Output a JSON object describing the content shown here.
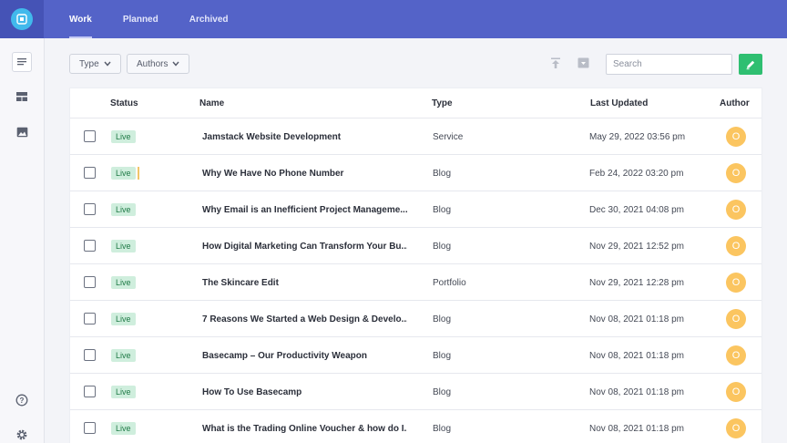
{
  "header": {
    "tabs": [
      {
        "label": "Work",
        "active": true
      },
      {
        "label": "Planned",
        "active": false
      },
      {
        "label": "Archived",
        "active": false
      }
    ]
  },
  "sidebar": {
    "items": [
      {
        "icon": "document-lines-icon",
        "active": true
      },
      {
        "icon": "layout-blocks-icon",
        "active": false
      },
      {
        "icon": "image-icon",
        "active": false
      }
    ],
    "bottom": [
      {
        "icon": "help-circle-icon"
      },
      {
        "icon": "gear-icon"
      }
    ]
  },
  "toolbar": {
    "type_filter": "Type",
    "authors_filter": "Authors",
    "search_placeholder": "Search",
    "search_value": ""
  },
  "table": {
    "columns": [
      "Status",
      "Name",
      "Type",
      "Last Updated",
      "Author"
    ],
    "rows": [
      {
        "status": "Live",
        "name": "Jamstack Website Development",
        "type": "Service",
        "updated": "May 29, 2022 03:56 pm",
        "author": "O"
      },
      {
        "status": "Live",
        "name": "Why We Have No Phone Number",
        "type": "Blog",
        "updated": "Feb 24, 2022 03:20 pm",
        "author": "O"
      },
      {
        "status": "Live",
        "name": "Why Email is an Inefficient Project Manageme...",
        "type": "Blog",
        "updated": "Dec 30, 2021 04:08 pm",
        "author": "O"
      },
      {
        "status": "Live",
        "name": "How Digital Marketing Can Transform Your Bu...",
        "type": "Blog",
        "updated": "Nov 29, 2021 12:52 pm",
        "author": "O"
      },
      {
        "status": "Live",
        "name": "The Skincare Edit",
        "type": "Portfolio",
        "updated": "Nov 29, 2021 12:28 pm",
        "author": "O"
      },
      {
        "status": "Live",
        "name": "7 Reasons We Started a Web Design & Develo...",
        "type": "Blog",
        "updated": "Nov 08, 2021 01:18 pm",
        "author": "O"
      },
      {
        "status": "Live",
        "name": "Basecamp – Our Productivity Weapon",
        "type": "Blog",
        "updated": "Nov 08, 2021 01:18 pm",
        "author": "O"
      },
      {
        "status": "Live",
        "name": "How To Use Basecamp",
        "type": "Blog",
        "updated": "Nov 08, 2021 01:18 pm",
        "author": "O"
      },
      {
        "status": "Live",
        "name": "What is the Trading Online Voucher & how do I...",
        "type": "Blog",
        "updated": "Nov 08, 2021 01:18 pm",
        "author": "O"
      }
    ]
  },
  "colors": {
    "header": "#5463c8",
    "accent_green": "#2fbf71",
    "badge_bg": "#cfeedd",
    "avatar": "#fbc560"
  }
}
